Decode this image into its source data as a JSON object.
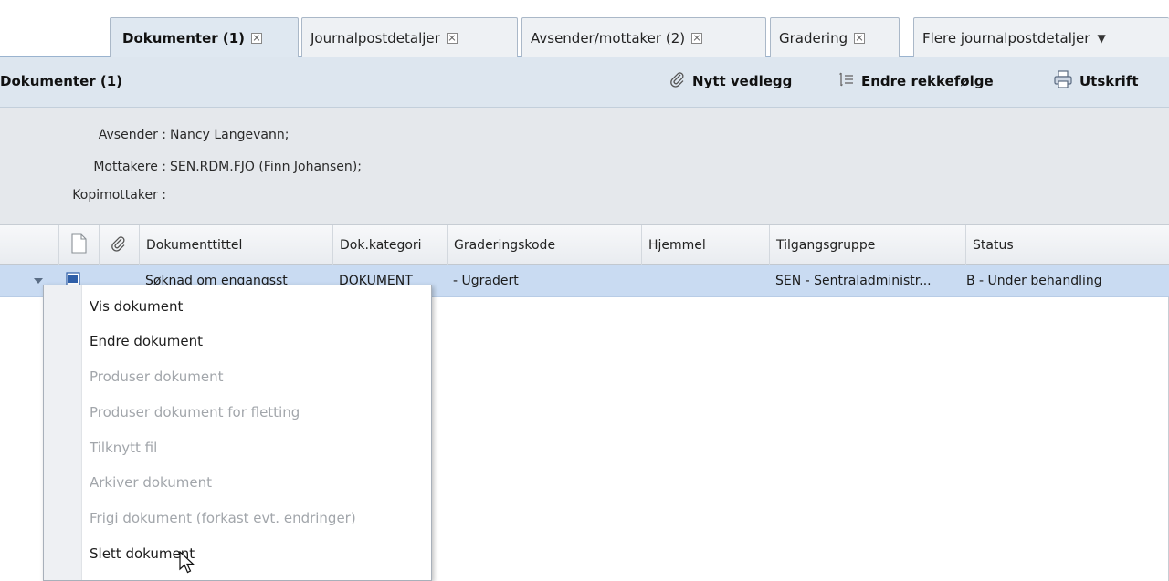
{
  "tabs": [
    {
      "label": "Dokumenter (1)",
      "active": true,
      "closable": true
    },
    {
      "label": "Journalpostdetaljer",
      "active": false,
      "closable": true
    },
    {
      "label": "Avsender/mottaker (2)",
      "active": false,
      "closable": true
    },
    {
      "label": "Gradering",
      "active": false,
      "closable": true
    },
    {
      "label": "Flere journalpostdetaljer",
      "active": false,
      "dropdown": true
    }
  ],
  "panel": {
    "title": "Dokumenter (1)",
    "toolbar": {
      "new_attachment": "Nytt vedlegg",
      "reorder": "Endre rekkefølge",
      "print": "Utskrift"
    }
  },
  "meta": {
    "sender_label": "Avsender :",
    "sender_value": "Nancy Langevann;",
    "recipients_label": "Mottakere :",
    "recipients_value": "SEN.RDM.FJO (Finn Johansen);",
    "cc_label": "Kopimottaker :",
    "cc_value": ""
  },
  "grid": {
    "columns": [
      "Dokumenttittel",
      "Dok.kategori",
      "Graderingskode",
      "Hjemmel",
      "Tilgangsgruppe",
      "Status"
    ],
    "rows": [
      {
        "title": "Søknad om engangsst",
        "category": "DOKUMENT",
        "grading": "- Ugradert",
        "authority": "",
        "access_group": "SEN - Sentraladministr...",
        "status": "B - Under behandling"
      }
    ]
  },
  "context_menu": {
    "items": [
      {
        "label": "Vis dokument",
        "enabled": true
      },
      {
        "label": "Endre dokument",
        "enabled": true
      },
      {
        "label": "Produser dokument",
        "enabled": false
      },
      {
        "label": "Produser dokument for fletting",
        "enabled": false
      },
      {
        "label": "Tilknytt fil",
        "enabled": false
      },
      {
        "label": "Arkiver dokument",
        "enabled": false
      },
      {
        "label": "Frigi dokument (forkast evt. endringer)",
        "enabled": false
      },
      {
        "label": "Slett dokument",
        "enabled": true
      }
    ]
  },
  "colors": {
    "selected_row": "#c9dbf2",
    "panel_header": "#dde6ef",
    "meta_bg": "#e5e8ec",
    "disabled_text": "#a2a6ab"
  },
  "icons": {
    "tab_close": "close-box-icon",
    "tab_dropdown": "chevron-down-icon",
    "new_attachment": "paperclip-icon",
    "reorder": "reorder-list-icon",
    "print": "printer-icon",
    "header_document": "document-icon",
    "header_attachment": "paperclip-icon",
    "row_expand": "expand-triangle-icon",
    "row_document": "word-document-icon",
    "cursor": "mouse-pointer-icon"
  }
}
